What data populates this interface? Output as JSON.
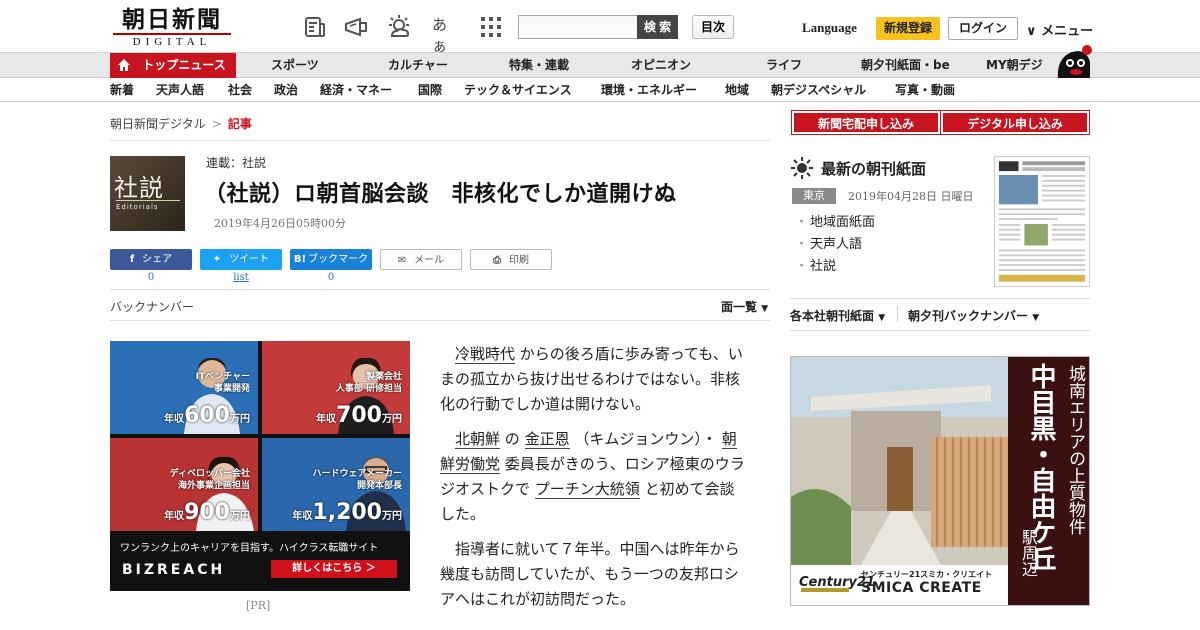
{
  "header": {
    "logo_kanji": "朝日新聞",
    "logo_latin": "DIGITAL",
    "icons": [
      "newspaper-icon",
      "megaphone-icon",
      "weather-icon",
      "font-size-icon",
      "grid-apps-icon"
    ],
    "font_size_label": "あぁ",
    "search_placeholder": "",
    "search_button": "検 索",
    "toc_button": "目次",
    "language": "Language",
    "register": "新規登録",
    "login": "ログイン",
    "menu": "メニュー"
  },
  "main_nav": [
    {
      "label": "トップニュース",
      "active": true
    },
    {
      "label": "スポーツ"
    },
    {
      "label": "カルチャー"
    },
    {
      "label": "特集・連載"
    },
    {
      "label": "オピニオン"
    },
    {
      "label": "ライフ"
    },
    {
      "label": "朝夕刊紙面・be"
    },
    {
      "label": "MY朝デジ"
    }
  ],
  "sub_nav": [
    "新着",
    "天声人語",
    "社会",
    "政治",
    "経済・マネー",
    "国際",
    "テック＆サイエンス",
    "環境・エネルギー",
    "地域",
    "朝デジスペシャル",
    "写真・動画"
  ],
  "breadcrumb": {
    "home": "朝日新聞デジタル",
    "sep": ">",
    "current": "記事"
  },
  "article": {
    "thumb_kanji": "社説",
    "thumb_latin": "Editorials",
    "series": "連載：社説",
    "headline": "（社説）ロ朝首脳会談　非核化でしか道開けぬ",
    "datetime": "2019年4月26日05時00分",
    "share": {
      "facebook": "シェア",
      "facebook_count": "0",
      "twitter": "ツイート",
      "twitter_count": "list",
      "hatena": "ブックマーク",
      "hatena_count": "0",
      "mail": "メール",
      "print": "印刷"
    },
    "backnumber": "バックナンバー",
    "menpage": "面一覧",
    "p1_kw1": "冷戦時代",
    "p1_rest": "からの後ろ盾に歩み寄っても、いまの孤立から抜け出せるわけではない。非核化の行動でしか道は開けない。",
    "p2_kw1": "北朝鮮",
    "p2_t1": "の",
    "p2_kw2": "金正恩",
    "p2_t2": "（キムジョンウン）・",
    "p2_kw3": "朝鮮労働党",
    "p2_t3": "委員長がきのう、ロシア極東のウラジオストクで",
    "p2_kw4": "プーチン大統領",
    "p2_t4": "と初めて会談した。",
    "p3": "指導者に就いて７年半。中国へは昨年から幾度も訪問していたが、もう一つの友邦ロシアへはこれが初訪問だった。"
  },
  "ad_left": {
    "cells": [
      {
        "role1": "ITベンチャー",
        "role2": "事業開発",
        "prefix": "年収",
        "amount": "600",
        "unit": "万円"
      },
      {
        "role1": "製薬会社",
        "role2": "人事部 研修担当",
        "prefix": "年収",
        "amount": "700",
        "unit": "万円"
      },
      {
        "role1": "ディベロッパー会社",
        "role2": "海外事業企画担当",
        "prefix": "年収",
        "amount": "900",
        "unit": "万円"
      },
      {
        "role1": "ハードウェアメーカー",
        "role2": "開発本部長",
        "prefix": "年収",
        "amount": "1,200",
        "unit": "万円"
      }
    ],
    "tagline": "ワンランク上のキャリアを目指す。ハイクラス転職サイト",
    "brand": "BIZREACH",
    "cta": "詳しくはこちら ＞",
    "pr": "[PR]"
  },
  "sidebar": {
    "apply_home": "新聞宅配申し込み",
    "apply_digital": "デジタル申し込み",
    "morning_title": "最新の朝刊紙面",
    "region": "東京",
    "paper_date": "2019年04月28日 日曜日",
    "links": [
      "地域面紙面",
      "天声人語",
      "社説"
    ],
    "shimen": "各本社朝刊紙面",
    "yuukan": "朝夕刊バックナンバー"
  },
  "ad_right": {
    "v1": "城南エリアの上質物件",
    "v2": "中目黒・自由ケ丘",
    "v3": "駅周辺",
    "c21": "Century21",
    "jp": "センチュリー21スミカ・クリエイト",
    "en": "SMICA CREATE"
  },
  "colors": {
    "brand_red": "#c8141e",
    "register_yellow": "#f7c21c",
    "link_blue": "#2a6ad1"
  }
}
